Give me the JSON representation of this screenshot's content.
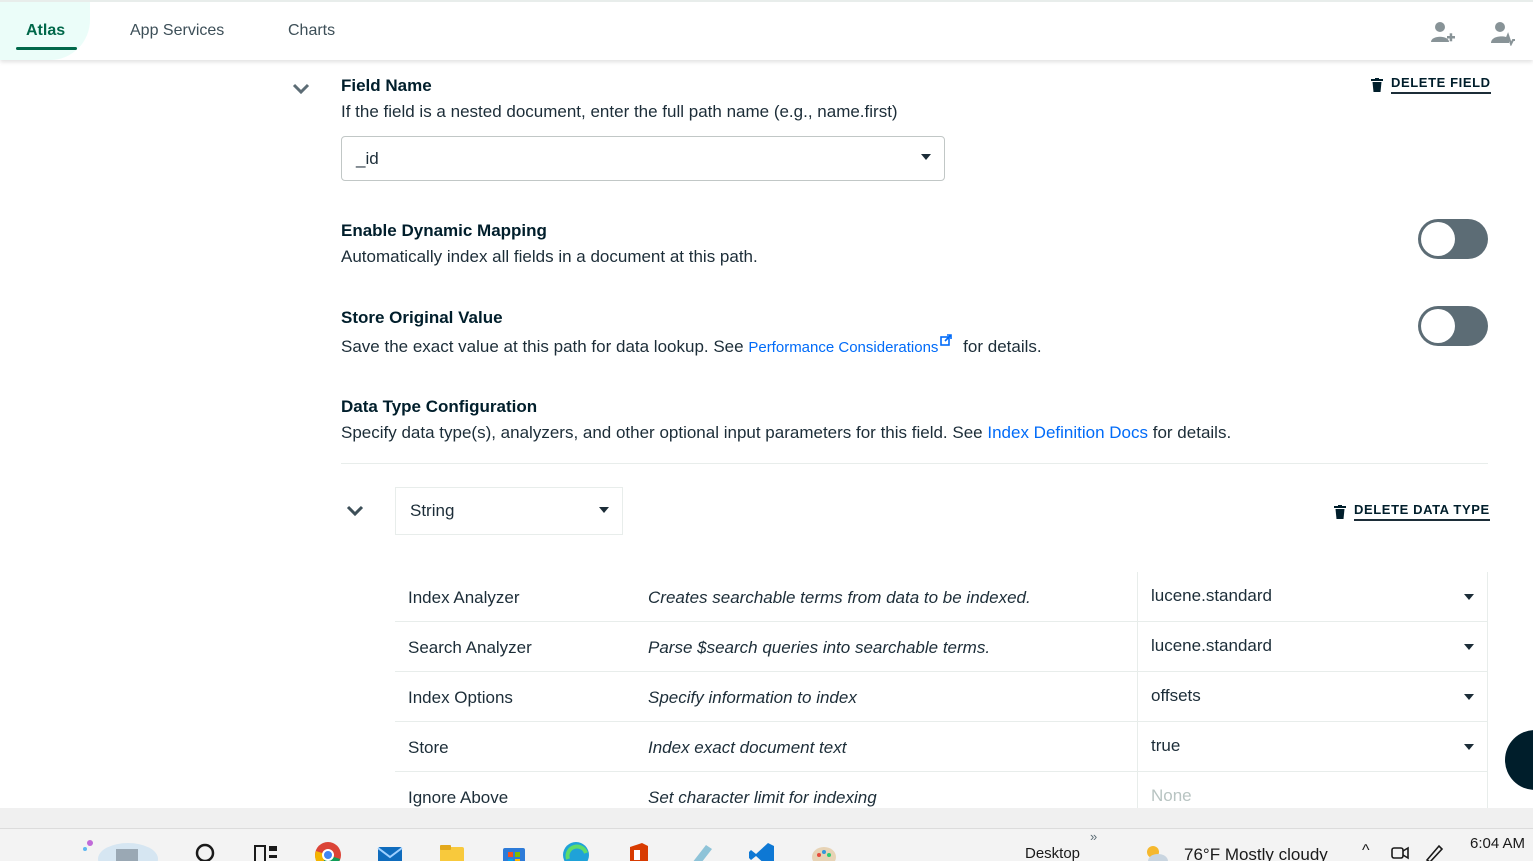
{
  "nav": {
    "tabs": [
      {
        "label": "Atlas",
        "active": true
      },
      {
        "label": "App Services",
        "active": false
      },
      {
        "label": "Charts",
        "active": false
      }
    ],
    "icons": [
      "add-user-icon",
      "user-activity-icon"
    ]
  },
  "field": {
    "title": "Field Name",
    "desc": "If the field is a nested document, enter the full path name (e.g., name.first)",
    "value": "_id",
    "delete_label": "DELETE FIELD"
  },
  "dynamic": {
    "title": "Enable Dynamic Mapping",
    "desc": "Automatically index all fields in a document at this path.",
    "enabled": false
  },
  "store_original": {
    "title": "Store Original Value",
    "desc_pre": "Save the exact value at this path for data lookup. See",
    "link": "Performance Considerations",
    "desc_post": "for details.",
    "enabled": false
  },
  "datatype": {
    "title": "Data Type Configuration",
    "desc_pre": "Specify data type(s), analyzers, and other optional input parameters for this field. See",
    "link": "Index Definition Docs",
    "desc_post": "for details.",
    "selected": "String",
    "delete_label": "DELETE DATA TYPE"
  },
  "rows": [
    {
      "name": "Index Analyzer",
      "desc": "Creates searchable terms from data to be indexed.",
      "value": "lucene.standard"
    },
    {
      "name": "Search Analyzer",
      "desc": "Parse $search queries into searchable terms.",
      "value": "lucene.standard"
    },
    {
      "name": "Index Options",
      "desc": "Specify information to index",
      "value": "offsets"
    },
    {
      "name": "Store",
      "desc": "Index exact document text",
      "value": "true"
    },
    {
      "name": "Ignore Above",
      "desc": "Set character limit for indexing",
      "placeholder": "None"
    }
  ],
  "taskbar": {
    "desktop": "Desktop",
    "chevron": "»",
    "weather": "76°F  Mostly cloudy",
    "time": "6:04 AM",
    "tray_up": "^"
  },
  "colors": {
    "accent": "#00684a",
    "link": "#016bf8",
    "toggle_off": "#5c6c75"
  }
}
